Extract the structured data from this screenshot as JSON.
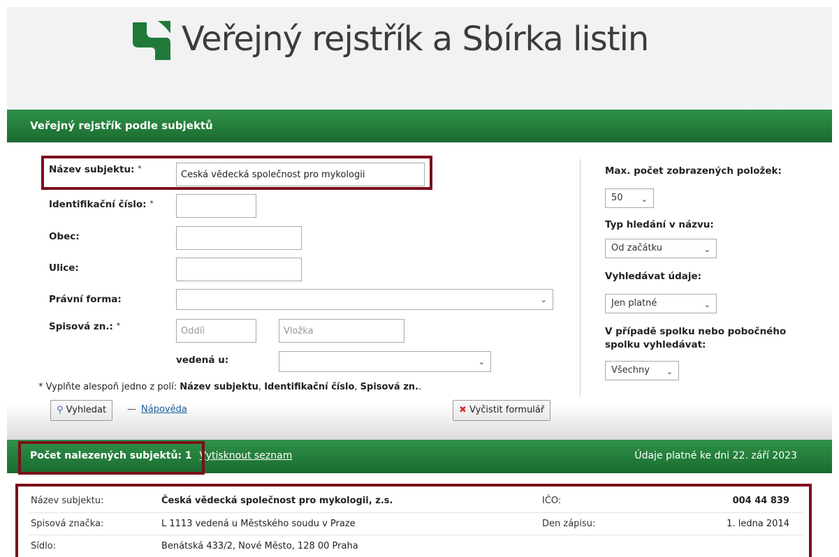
{
  "header": {
    "title": "Veřejný rejstřík a Sbírka listin",
    "logo_color": "#1f7a3a"
  },
  "section_title": "Veřejný rejstřík podle subjektů",
  "form": {
    "name_label": "Název subjektu:",
    "name_value": "Česká vědecká společnost pro mykologii",
    "ico_label": "Identifikační číslo:",
    "obec_label": "Obec:",
    "ulice_label": "Ulice:",
    "pravni_forma_label": "Právní forma:",
    "spisova_label": "Spisová zn.:",
    "oddil_placeholder": "Oddíl",
    "vlozka_placeholder": "Vložka",
    "vedena_label": "vedená u:",
    "required_mark": "*",
    "note_prefix": "* Vyplňte alespoň jedno z polí: ",
    "note_field1": "Název subjektu",
    "note_sep1": ", ",
    "note_field2": "Identifikační číslo",
    "note_sep2": ", ",
    "note_field3": "Spisová zn.",
    "note_suffix": ".",
    "search_button": "Vyhledat",
    "dash": "—",
    "help_link": "Nápověda",
    "clear_button": "Vyčistit formulář"
  },
  "options": {
    "max_label": "Max. počet zobrazených položek:",
    "max_value": "50",
    "typ_label": "Typ hledání v názvu:",
    "typ_value": "Od začátku",
    "vyhledavat_label": "Vyhledávat údaje:",
    "vyhledavat_value": "Jen platné",
    "spolek_label_1": "V případě spolku nebo pobočného",
    "spolek_label_2": "spolku vyhledávat:",
    "spolek_value": "Všechny"
  },
  "results": {
    "count_label": "Počet nalezených subjektů: 1",
    "print_link": "Vytisknout seznam",
    "valid_date": "Údaje platné ke dni 22. září 2023",
    "rows": [
      {
        "label": "Název subjektu:",
        "value": "Česká vědecká společnost pro mykologii, z.s.",
        "label2": "IČO:",
        "value2": "004 44 839"
      },
      {
        "label": "Spisová značka:",
        "value": "L 1113 vedená u Městského soudu v Praze",
        "label2": "Den zápisu:",
        "value2": "1. ledna 2014"
      },
      {
        "label": "Sídlo:",
        "value": "Benátská 433/2, Nové Město, 128 00 Praha",
        "label2": "",
        "value2": ""
      }
    ]
  },
  "colors": {
    "green": "#1f7a3a",
    "highlight": "#7a0e1d"
  }
}
